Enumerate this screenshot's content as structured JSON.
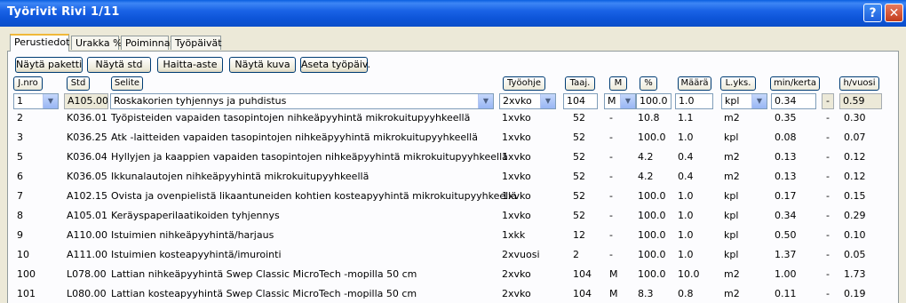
{
  "window": {
    "title": "Työrivit   Rivi 1/11",
    "help_label": "?",
    "close_label": "✕"
  },
  "tabs": [
    "Perustiedot",
    "Urakka %",
    "Poiminnat",
    "Työpäivät"
  ],
  "toolbar": [
    "Näytä paketti",
    "Näytä std",
    "Haitta-aste",
    "Näytä kuva",
    "Aseta työpäiv."
  ],
  "columns": {
    "jnro": "J.nro",
    "std": "Std",
    "selite": "Selite",
    "tyoohje": "Työohje",
    "taaj": "Taaj.",
    "m": "M",
    "pct": "%",
    "maara": "Määrä",
    "lyks": "L.yks.",
    "minkerta": "min/kerta",
    "hvuosi": "h/vuosi"
  },
  "edit_row": {
    "jnro": "1",
    "std": "A105.00",
    "selite": "Roskakorien tyhjennys ja puhdistus",
    "tyoohje": "2xvko",
    "taaj": "104",
    "m": "M",
    "pct": "100.0",
    "maara": "1.0",
    "lyks": "kpl",
    "minkerta": "0.34",
    "dash": "-",
    "hvuosi": "0.59"
  },
  "rows": [
    {
      "jnro": "2",
      "std": "K036.01",
      "selite": "Työpisteiden vapaiden tasopintojen nihkeäpyyhintä mikrokuitupyyhkeellä",
      "tyoohje": "1xvko",
      "taaj": "52",
      "m": "-",
      "pct": "10.8",
      "maara": "1.1",
      "lyks": "m2",
      "minkerta": "0.35",
      "dash": "-",
      "hvuosi": "0.30"
    },
    {
      "jnro": "3",
      "std": "K036.25",
      "selite": "Atk -laitteiden vapaiden tasopintojen nihkeäpyyhintä mikrokuitupyyhkeellä",
      "tyoohje": "1xvko",
      "taaj": "52",
      "m": "-",
      "pct": "100.0",
      "maara": "1.0",
      "lyks": "kpl",
      "minkerta": "0.08",
      "dash": "-",
      "hvuosi": "0.07"
    },
    {
      "jnro": "5",
      "std": "K036.04",
      "selite": "Hyllyjen ja kaappien vapaiden tasopintojen nihkeäpyyhintä mikrokuitupyyhkeellä",
      "tyoohje": "1xvko",
      "taaj": "52",
      "m": "-",
      "pct": "4.2",
      "maara": "0.4",
      "lyks": "m2",
      "minkerta": "0.13",
      "dash": "-",
      "hvuosi": "0.12"
    },
    {
      "jnro": "6",
      "std": "K036.05",
      "selite": "Ikkunalautojen nihkeäpyyhintä mikrokuitupyyhkeellä",
      "tyoohje": "1xvko",
      "taaj": "52",
      "m": "-",
      "pct": "4.2",
      "maara": "0.4",
      "lyks": "m2",
      "minkerta": "0.13",
      "dash": "-",
      "hvuosi": "0.12"
    },
    {
      "jnro": "7",
      "std": "A102.15",
      "selite": "Ovista ja ovenpielistä likaantuneiden kohtien kosteapyyhintä mikrokuitupyyhkeellä",
      "tyoohje": "1xvko",
      "taaj": "52",
      "m": "-",
      "pct": "100.0",
      "maara": "1.0",
      "lyks": "kpl",
      "minkerta": "0.17",
      "dash": "-",
      "hvuosi": "0.15"
    },
    {
      "jnro": "8",
      "std": "A105.01",
      "selite": "Keräyspaperilaatikoiden tyhjennys",
      "tyoohje": "1xvko",
      "taaj": "52",
      "m": "-",
      "pct": "100.0",
      "maara": "1.0",
      "lyks": "kpl",
      "minkerta": "0.34",
      "dash": "-",
      "hvuosi": "0.29"
    },
    {
      "jnro": "9",
      "std": "A110.00",
      "selite": "Istuimien nihkeäpyyhintä/harjaus",
      "tyoohje": "1xkk",
      "taaj": "12",
      "m": "-",
      "pct": "100.0",
      "maara": "1.0",
      "lyks": "kpl",
      "minkerta": "0.50",
      "dash": "-",
      "hvuosi": "0.10"
    },
    {
      "jnro": "10",
      "std": "A111.00",
      "selite": "Istuimien kosteapyyhintä/imurointi",
      "tyoohje": "2xvuosi",
      "taaj": "2",
      "m": "-",
      "pct": "100.0",
      "maara": "1.0",
      "lyks": "kpl",
      "minkerta": "1.37",
      "dash": "-",
      "hvuosi": "0.05"
    },
    {
      "jnro": "100",
      "std": "L078.00",
      "selite": "Lattian nihkeäpyyhintä Swep Classic MicroTech -mopilla 50 cm",
      "tyoohje": "2xvko",
      "taaj": "104",
      "m": "M",
      "pct": "100.0",
      "maara": "10.0",
      "lyks": "m2",
      "minkerta": "1.00",
      "dash": "-",
      "hvuosi": "1.73"
    },
    {
      "jnro": "101",
      "std": "L080.00",
      "selite": "Lattian kosteapyyhintä Swep Classic MicroTech -mopilla 50 cm",
      "tyoohje": "2xvko",
      "taaj": "104",
      "m": "M",
      "pct": "8.3",
      "maara": "0.8",
      "lyks": "m2",
      "minkerta": "0.11",
      "dash": "-",
      "hvuosi": "0.19"
    }
  ]
}
